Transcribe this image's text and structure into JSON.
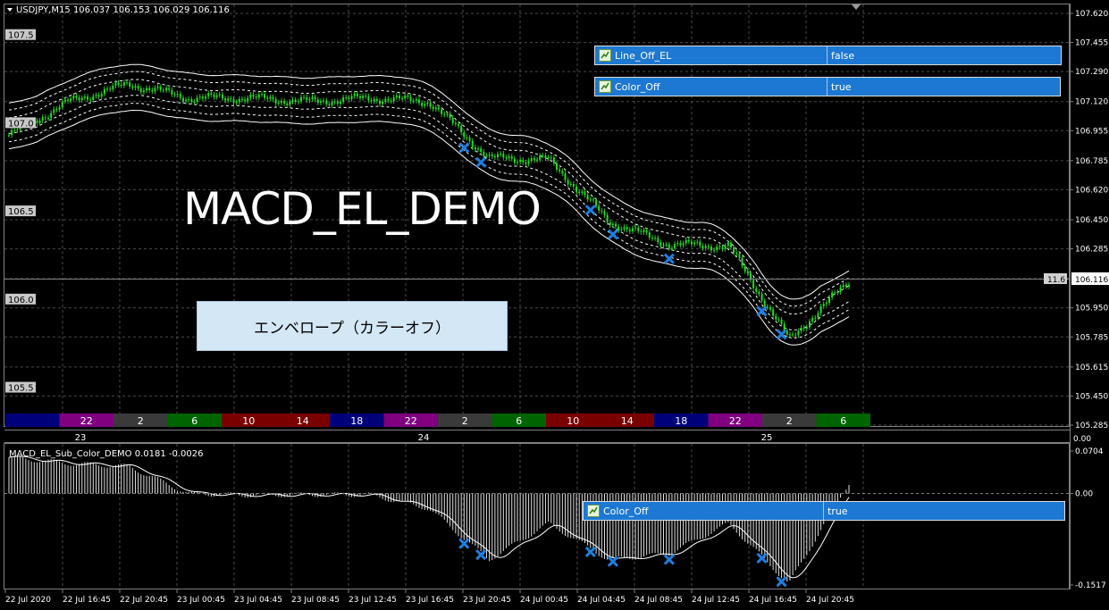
{
  "header": {
    "symbol_line": "USDJPY,M15  106.037 106.153 106.029 106.116"
  },
  "overlay": {
    "title": "MACD_EL_DEMO",
    "label_box": "エンベロープ（カラーオフ）"
  },
  "params": [
    {
      "name": "Line_Off_EL",
      "value": "false"
    },
    {
      "name": "Color_Off",
      "value": "true"
    },
    {
      "name": "Color_Off",
      "value": "true"
    }
  ],
  "main_axis": {
    "right_ticks": [
      "107.620",
      "107.455",
      "107.290",
      "107.120",
      "106.955",
      "106.785",
      "106.620",
      "106.450",
      "106.285",
      "106.116",
      "105.950",
      "105.785",
      "105.615",
      "105.450",
      "105.285"
    ],
    "left_labels": [
      "107.5",
      "107.0",
      "106.5",
      "106.0",
      "105.5"
    ],
    "current_price": "106.116",
    "price_tag": "11.6",
    "colors": {
      "bull_candle": "#22cc22",
      "bear_candle": "#22cc22",
      "band": "#ffffff",
      "cross": "#1e7fe0"
    }
  },
  "hour_strip": {
    "cells": [
      {
        "label": "",
        "color": "#00007a"
      },
      {
        "label": "22",
        "color": "#800080"
      },
      {
        "label": "2",
        "color": "#3a3a3a"
      },
      {
        "label": "6",
        "color": "#006400"
      },
      {
        "label": "10",
        "color": "#7a0000"
      },
      {
        "label": "14",
        "color": "#7a0000"
      },
      {
        "label": "18",
        "color": "#00007a"
      },
      {
        "label": "22",
        "color": "#800080"
      },
      {
        "label": "2",
        "color": "#3a3a3a"
      },
      {
        "label": "6",
        "color": "#006400"
      },
      {
        "label": "10",
        "color": "#7a0000"
      },
      {
        "label": "14",
        "color": "#7a0000"
      },
      {
        "label": "18",
        "color": "#00007a"
      },
      {
        "label": "22",
        "color": "#800080"
      },
      {
        "label": "2",
        "color": "#3a3a3a"
      },
      {
        "label": "6",
        "color": "#006400"
      }
    ],
    "day_labels": [
      "23",
      "24",
      "25"
    ],
    "right_label": "0.00"
  },
  "sub_window": {
    "title": "MACD_EL_Sub_Color_DEMO 0.0181 -0.0026",
    "right_ticks": [
      "0.0704",
      "0.00",
      "-0.1517"
    ]
  },
  "time_axis": {
    "labels": [
      "22 Jul 2020",
      "22 Jul 16:45",
      "22 Jul 20:45",
      "23 Jul 00:45",
      "23 Jul 04:45",
      "23 Jul 08:45",
      "23 Jul 12:45",
      "23 Jul 16:45",
      "23 Jul 20:45",
      "24 Jul 00:45",
      "24 Jul 04:45",
      "24 Jul 08:45",
      "24 Jul 12:45",
      "24 Jul 16:45",
      "24 Jul 20:45"
    ]
  },
  "chart_data": [
    {
      "type": "line",
      "title": "USDJPY,M15",
      "x": [
        "22 Jul 2020",
        "22 Jul 16:45",
        "22 Jul 20:45",
        "23 Jul 00:45",
        "23 Jul 04:45",
        "23 Jul 08:45",
        "23 Jul 12:45",
        "23 Jul 16:45",
        "23 Jul 20:45",
        "24 Jul 00:45",
        "24 Jul 04:45",
        "24 Jul 08:45",
        "24 Jul 12:45",
        "24 Jul 16:45",
        "24 Jul 20:45"
      ],
      "series": [
        {
          "values": [
            106.93,
            107.12,
            107.22,
            107.14,
            107.14,
            107.12,
            107.14,
            107.12,
            106.8,
            106.79,
            106.44,
            106.31,
            106.3,
            105.77,
            106.1
          ]
        }
      ],
      "ylim": [
        105.285,
        107.62
      ]
    },
    {
      "type": "bar",
      "title": "MACD_EL_Sub_Color_DEMO 0.0181 -0.0026",
      "x": [
        "22 Jul 2020",
        "22 Jul 16:45",
        "22 Jul 20:45",
        "23 Jul 00:45",
        "23 Jul 04:45",
        "23 Jul 08:45",
        "23 Jul 12:45",
        "23 Jul 16:45",
        "23 Jul 20:45",
        "24 Jul 00:45",
        "24 Jul 04:45",
        "24 Jul 08:45",
        "24 Jul 12:45",
        "24 Jul 16:45",
        "24 Jul 20:45"
      ],
      "values": [
        0.06,
        0.05,
        0.045,
        0.0,
        -0.003,
        -0.002,
        -0.002,
        -0.025,
        -0.11,
        -0.05,
        -0.11,
        -0.1,
        -0.05,
        -0.15,
        0.018
      ],
      "ylim": [
        -0.1517,
        0.0704
      ]
    }
  ]
}
